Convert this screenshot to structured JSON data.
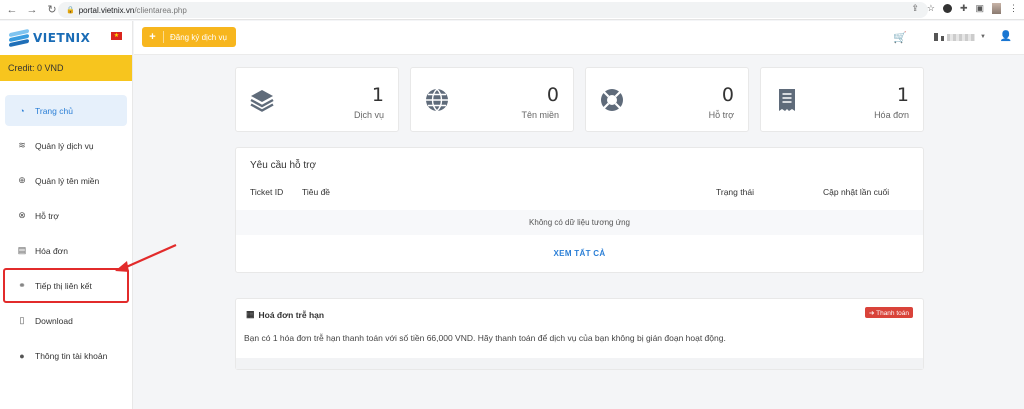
{
  "browser": {
    "url_host": "portal.vietnix.vn",
    "url_path": "/clientarea.php"
  },
  "sidebar": {
    "logo_text": "VIETNIX",
    "credit": "Credit: 0 VND",
    "items": [
      {
        "label": "Trang chủ",
        "icon": "dashboard-icon",
        "active": true
      },
      {
        "label": "Quản lý dịch vụ",
        "icon": "layers-icon"
      },
      {
        "label": "Quản lý tên miền",
        "icon": "globe-icon"
      },
      {
        "label": "Hỗ trợ",
        "icon": "lifebuoy-icon"
      },
      {
        "label": "Hóa đơn",
        "icon": "invoice-icon"
      },
      {
        "label": "Tiếp thị liên kết",
        "icon": "handshake-icon",
        "highlighted": true
      },
      {
        "label": "Download",
        "icon": "file-icon"
      },
      {
        "label": "Thông tin tài khoản",
        "icon": "user-icon"
      }
    ]
  },
  "header": {
    "register_label": "Đăng ký dịch vụ",
    "register_plus": "+"
  },
  "stats": [
    {
      "value": "1",
      "label": "Dịch vụ",
      "icon": "layers-icon"
    },
    {
      "value": "0",
      "label": "Tên miền",
      "icon": "globe-icon"
    },
    {
      "value": "0",
      "label": "Hỗ trợ",
      "icon": "lifebuoy-icon"
    },
    {
      "value": "1",
      "label": "Hóa đơn",
      "icon": "invoice-icon"
    }
  ],
  "support": {
    "title": "Yêu cầu hỗ trợ",
    "columns": [
      "Ticket ID",
      "Tiêu đề",
      "Trạng thái",
      "Cập nhật lần cuối"
    ],
    "empty_text": "Không có dữ liệu tương ứng",
    "see_all": "XEM TẤT CẢ"
  },
  "overdue": {
    "title": "Hoá đơn trễ hạn",
    "pay_label": "➔ Thanh toán",
    "message": "Bạn có 1 hóa đơn trễ hạn thanh toán với số tiền 66,000 VND. Hãy thanh toán để dịch vụ của bạn không bị gián đoạn hoạt động."
  },
  "colors": {
    "accent": "#2b7fd6",
    "credit_bar": "#f7c51e",
    "register_button": "#f7b61e",
    "annotation_red": "#e22b2b",
    "pay_button": "#d9433a"
  }
}
